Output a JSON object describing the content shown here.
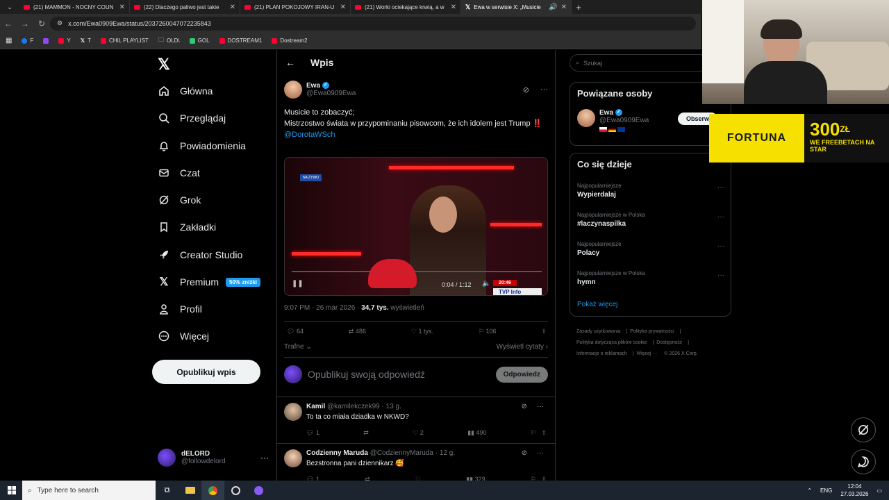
{
  "browser": {
    "tabs": [
      {
        "title": "(21) MAMMON - NOCNY COUN",
        "icon": "youtube-icon",
        "active": false
      },
      {
        "title": "(22) Dlaczego paliwo jest takie",
        "icon": "youtube-icon",
        "active": false
      },
      {
        "title": "(21) PLAN POKOJOWY IRAN-U",
        "icon": "youtube-icon",
        "active": false
      },
      {
        "title": "(21) Worki ociekające krwią, a w",
        "icon": "youtube-icon",
        "active": false
      },
      {
        "title": "Ewa w serwisie X: „Musicie",
        "icon": "x-logo-icon",
        "active": true
      }
    ],
    "url": "x.com/Ewa0909Ewa/status/2037260047072235843",
    "bookmarks": [
      {
        "label": "F",
        "color": "#1877f2"
      },
      {
        "label": "",
        "color": "#9146ff"
      },
      {
        "label": "Y",
        "color": "#ff0033"
      },
      {
        "label": "T",
        "color": "#ffffff"
      },
      {
        "label": "CHIL PLAYLIST",
        "color": "#ff0033"
      },
      {
        "label": "OLD\\",
        "color": "#aaaaaa"
      },
      {
        "label": "GOL",
        "color": "#2ecc71"
      },
      {
        "label": "DOSTREAM1",
        "color": "#ff0033"
      },
      {
        "label": "Dostream2",
        "color": "#ff0033"
      }
    ]
  },
  "nav": {
    "items": [
      {
        "label": "Główna",
        "icon": "home-icon"
      },
      {
        "label": "Przeglądaj",
        "icon": "search-icon"
      },
      {
        "label": "Powiadomienia",
        "icon": "bell-icon"
      },
      {
        "label": "Czat",
        "icon": "mail-icon"
      },
      {
        "label": "Grok",
        "icon": "grok-icon"
      },
      {
        "label": "Zakładki",
        "icon": "bookmark-icon"
      },
      {
        "label": "Creator Studio",
        "icon": "rocket-icon"
      },
      {
        "label": "Premium",
        "icon": "x-icon"
      },
      {
        "label": "Profil",
        "icon": "person-icon"
      },
      {
        "label": "Więcej",
        "icon": "more-circle-icon"
      }
    ],
    "premium_badge": "50% zniżki",
    "post_button": "Opublikuj wpis",
    "account_name": "dELORD",
    "account_handle": "@followdelord"
  },
  "post": {
    "header": "Wpis",
    "author": "Ewa",
    "handle": "@Ewa0909Ewa",
    "text_line1": "Musicie to zobaczyć;",
    "text_line2": "Mistrzostwo świata w przypominaniu pisowcom, że ich idolem jest Trump",
    "text_emoji": "‼️",
    "mention": "@DorotaWSch",
    "video": {
      "live_tag": "NA ŻYWO",
      "time": "0:04 / 1:12",
      "clock": "20:46",
      "channel": "TVP Info"
    },
    "time": "9:07 PM · 26 mar 2026 · ",
    "views": "34,7 tys.",
    "views_label": " wyświetleń",
    "replies": "64",
    "reposts": "486",
    "likes": "1 tys.",
    "bookmarks": "106",
    "sort": "Trafne",
    "quotes": "Wyświetl cytaty",
    "reply_placeholder": "Opublikuj swoją odpowiedź",
    "reply_button": "Odpowiedz"
  },
  "comments": [
    {
      "name": "Kamil",
      "handle": "@kamilekczek99 · 13 g.",
      "text": "To ta co miała dziadka w NKWD?",
      "replies": "1",
      "reposts": "",
      "likes": "2",
      "views": "490"
    },
    {
      "name": "Codzienny Maruda",
      "handle": "@CodziennyMaruda · 12 g.",
      "text": "Bezstronna pani dziennikarz 🥰",
      "replies": "1",
      "reposts": "",
      "likes": "",
      "views": "329"
    }
  ],
  "sidebar": {
    "search_placeholder": "Szukaj",
    "related_title": "Powiązane osoby",
    "related_name": "Ewa",
    "related_handle": "@Ewa0909Ewa",
    "follow_label": "Obserw",
    "trends_title": "Co się dzieje",
    "trends": [
      {
        "category": "Najpopularniejsze",
        "name": "Wypierdalaj"
      },
      {
        "category": "Najpopularniejsze w Polska",
        "name": "#laczynaspilka"
      },
      {
        "category": "Najpopularniejsze",
        "name": "Polacy"
      },
      {
        "category": "Najpopularniejsze w Polska",
        "name": "hymn"
      }
    ],
    "show_more": "Pokaż więcej",
    "footer_links": [
      "Zasady użytkowania",
      "Polityka prywatności",
      "Polityka dotycząca plików cookie",
      "Dostępność",
      "Informacje o reklamach",
      "Więcej ···",
      "© 2026 X Corp."
    ]
  },
  "overlay": {
    "fortuna_logo": "FORTUNA",
    "fortuna_amount": "300",
    "fortuna_currency": "ZŁ",
    "fortuna_tagline": "WE FREEBETACH NA STAR"
  },
  "taskbar": {
    "search_placeholder": "Type here to search",
    "lang": "ENG",
    "time": "12:04",
    "date": "27.03.2026"
  },
  "colors": {
    "accent": "#1d9bf0",
    "background": "#000000",
    "fortuna_yellow": "#f5e000"
  }
}
